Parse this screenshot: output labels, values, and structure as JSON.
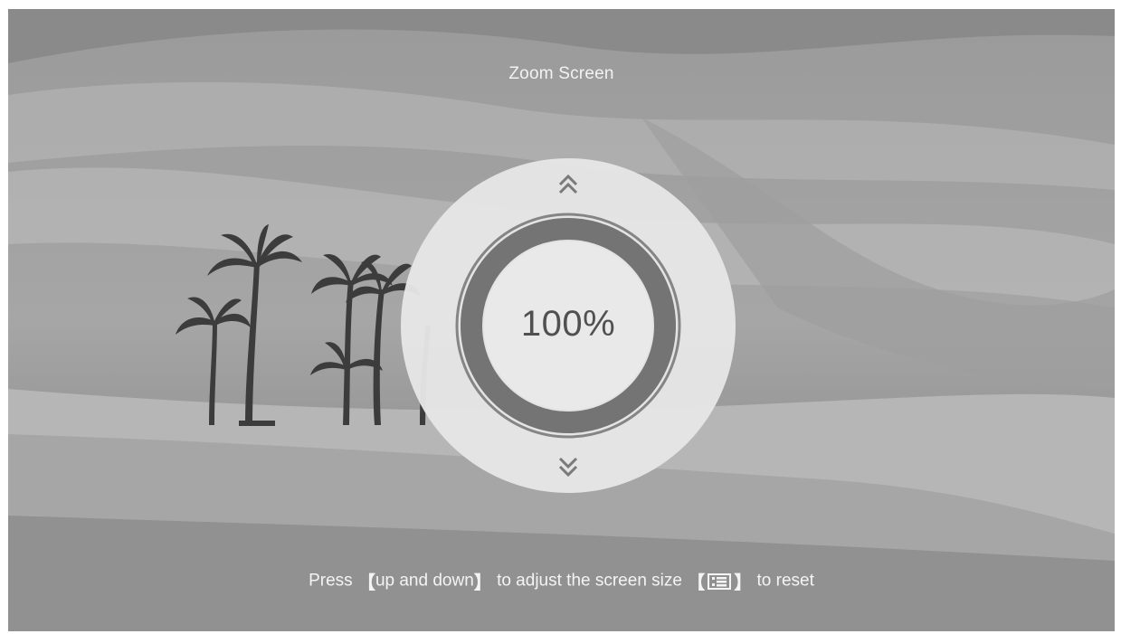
{
  "screen": {
    "title": "Zoom Screen",
    "zoom_value": "100%",
    "zoom_percent": 100
  },
  "hint": {
    "prefix": "Press",
    "open_bracket_1": "【",
    "keys_text": "up and down",
    "close_bracket_1": "】",
    "middle_text": "to adjust the screen size",
    "open_bracket_2": "【",
    "close_bracket_2": "】",
    "suffix": "to reset"
  },
  "icons": {
    "up": "double-chevron-up-icon",
    "down": "double-chevron-down-icon",
    "menu_key": "menu-key-icon"
  },
  "colors": {
    "background": "#8e8e8e",
    "dial_disc": "#e4e4e4",
    "ring": "#7a7a7a",
    "text_light": "#f4f4f4",
    "value_text": "#505050"
  }
}
